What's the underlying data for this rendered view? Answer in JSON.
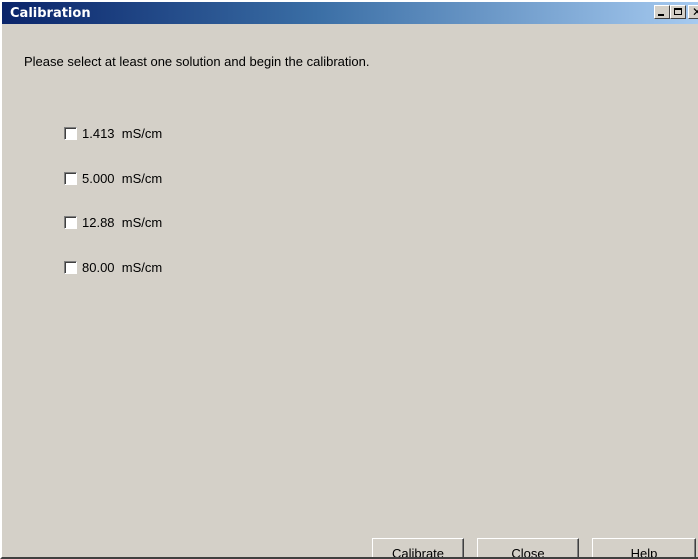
{
  "window": {
    "title": "Calibration"
  },
  "prompt": "Please select at least one solution and begin the calibration.",
  "options": [
    {
      "label": "1.413  mS/cm",
      "checked": false
    },
    {
      "label": "5.000  mS/cm",
      "checked": false
    },
    {
      "label": "12.88  mS/cm",
      "checked": false
    },
    {
      "label": "80.00  mS/cm",
      "checked": false
    }
  ],
  "buttons": {
    "calibrate": "Calibrate",
    "close": "Close",
    "help": "Help"
  },
  "colors": {
    "titlebar_start": "#0a246a",
    "titlebar_end": "#a6caf0",
    "face": "#d4d0c8"
  }
}
